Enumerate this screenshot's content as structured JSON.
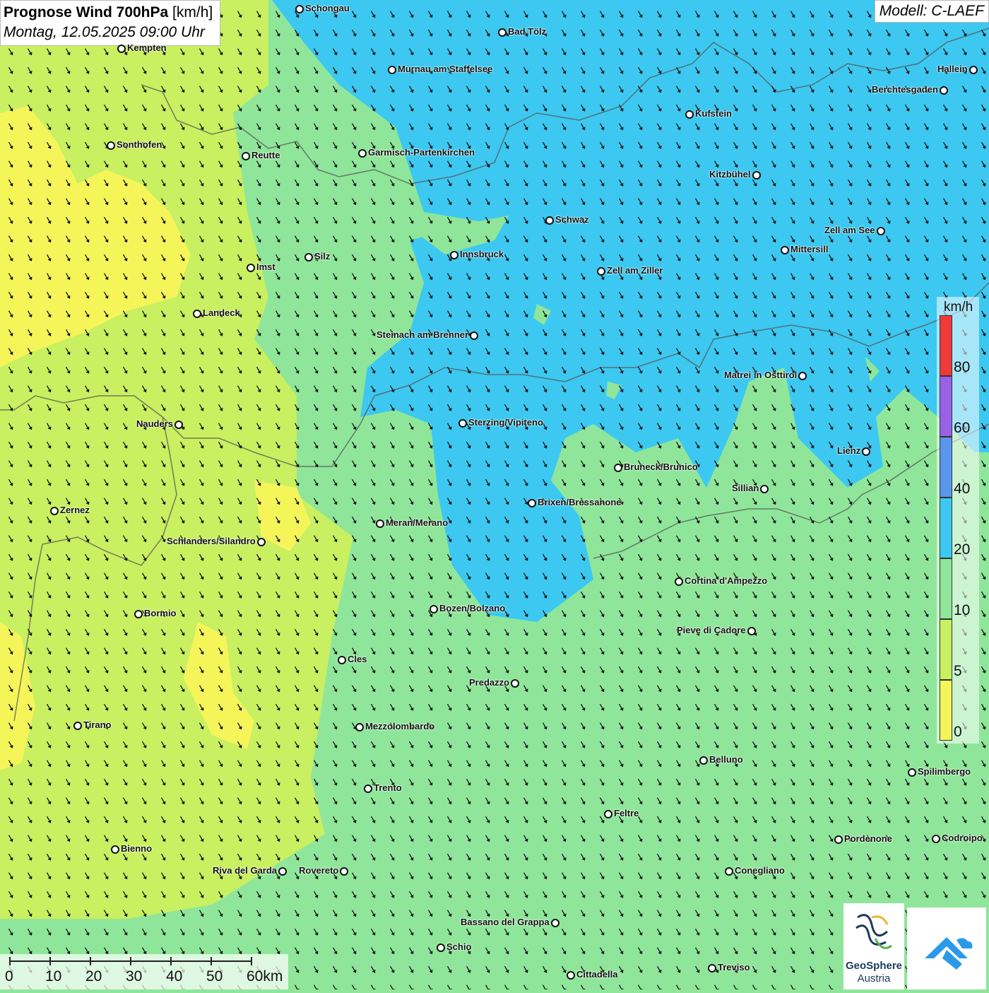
{
  "header": {
    "title_bold": "Prognose Wind 700hPa",
    "title_unit": "[km/h]",
    "subtitle": "Montag, 12.05.2025 09:00 Uhr",
    "model": "Modell: C-LAEF"
  },
  "legend": {
    "unit": "km/h",
    "ticks": [
      "0",
      "5",
      "10",
      "20",
      "40",
      "60",
      "80"
    ],
    "colors": [
      "#f5f55a",
      "#c8f060",
      "#8fe69a",
      "#3cc8f0",
      "#5a96eb",
      "#9a60e8",
      "#f03a3a"
    ]
  },
  "scale": {
    "labels": [
      "0",
      "10",
      "20",
      "30",
      "40",
      "50",
      "60km"
    ]
  },
  "logos": {
    "geosphere_line1": "GeoSphere",
    "geosphere_line2": "Austria"
  },
  "cities": [
    {
      "name": "Schongau"
    },
    {
      "name": "Bad Tölz"
    },
    {
      "name": "Kempten"
    },
    {
      "name": "Murnau am Staffelsee"
    },
    {
      "name": "Hallein"
    },
    {
      "name": "Berchtesgaden"
    },
    {
      "name": "Kufstein"
    },
    {
      "name": "Sonthofen"
    },
    {
      "name": "Reutte"
    },
    {
      "name": "Garmisch-Partenkirchen"
    },
    {
      "name": "Kitzbühel"
    },
    {
      "name": "Schwaz"
    },
    {
      "name": "Zell am See"
    },
    {
      "name": "Innsbruck"
    },
    {
      "name": "Mittersill"
    },
    {
      "name": "Silz"
    },
    {
      "name": "Imst"
    },
    {
      "name": "Zell am Ziller"
    },
    {
      "name": "Landeck"
    },
    {
      "name": "Steinach am Brenner"
    },
    {
      "name": "Matrei in Osttirol"
    },
    {
      "name": "Nauders"
    },
    {
      "name": "Sterzing/Vipiteno"
    },
    {
      "name": "Lienz"
    },
    {
      "name": "Bruneck/Brunico"
    },
    {
      "name": "Sillian"
    },
    {
      "name": "Zernez"
    },
    {
      "name": "Brixen/Bressanone"
    },
    {
      "name": "Meran/Merano"
    },
    {
      "name": "Schlanders/Silandro"
    },
    {
      "name": "Cortina d'Ampezzo"
    },
    {
      "name": "Bozen/Bolzano"
    },
    {
      "name": "Bormio"
    },
    {
      "name": "Pieve di Cadore"
    },
    {
      "name": "Cles"
    },
    {
      "name": "Predazzo"
    },
    {
      "name": "Tirano"
    },
    {
      "name": "Mezzolombardo"
    },
    {
      "name": "Belluno"
    },
    {
      "name": "Spilimbergo"
    },
    {
      "name": "Trento"
    },
    {
      "name": "Feltre"
    },
    {
      "name": "Pordenone"
    },
    {
      "name": "Codroipo"
    },
    {
      "name": "Bienno"
    },
    {
      "name": "Riva del Garda"
    },
    {
      "name": "Rovereto"
    },
    {
      "name": "Conegliano"
    },
    {
      "name": "Bassano del Grappa"
    },
    {
      "name": "Schio"
    },
    {
      "name": "Treviso"
    },
    {
      "name": "Cittadella"
    }
  ]
}
